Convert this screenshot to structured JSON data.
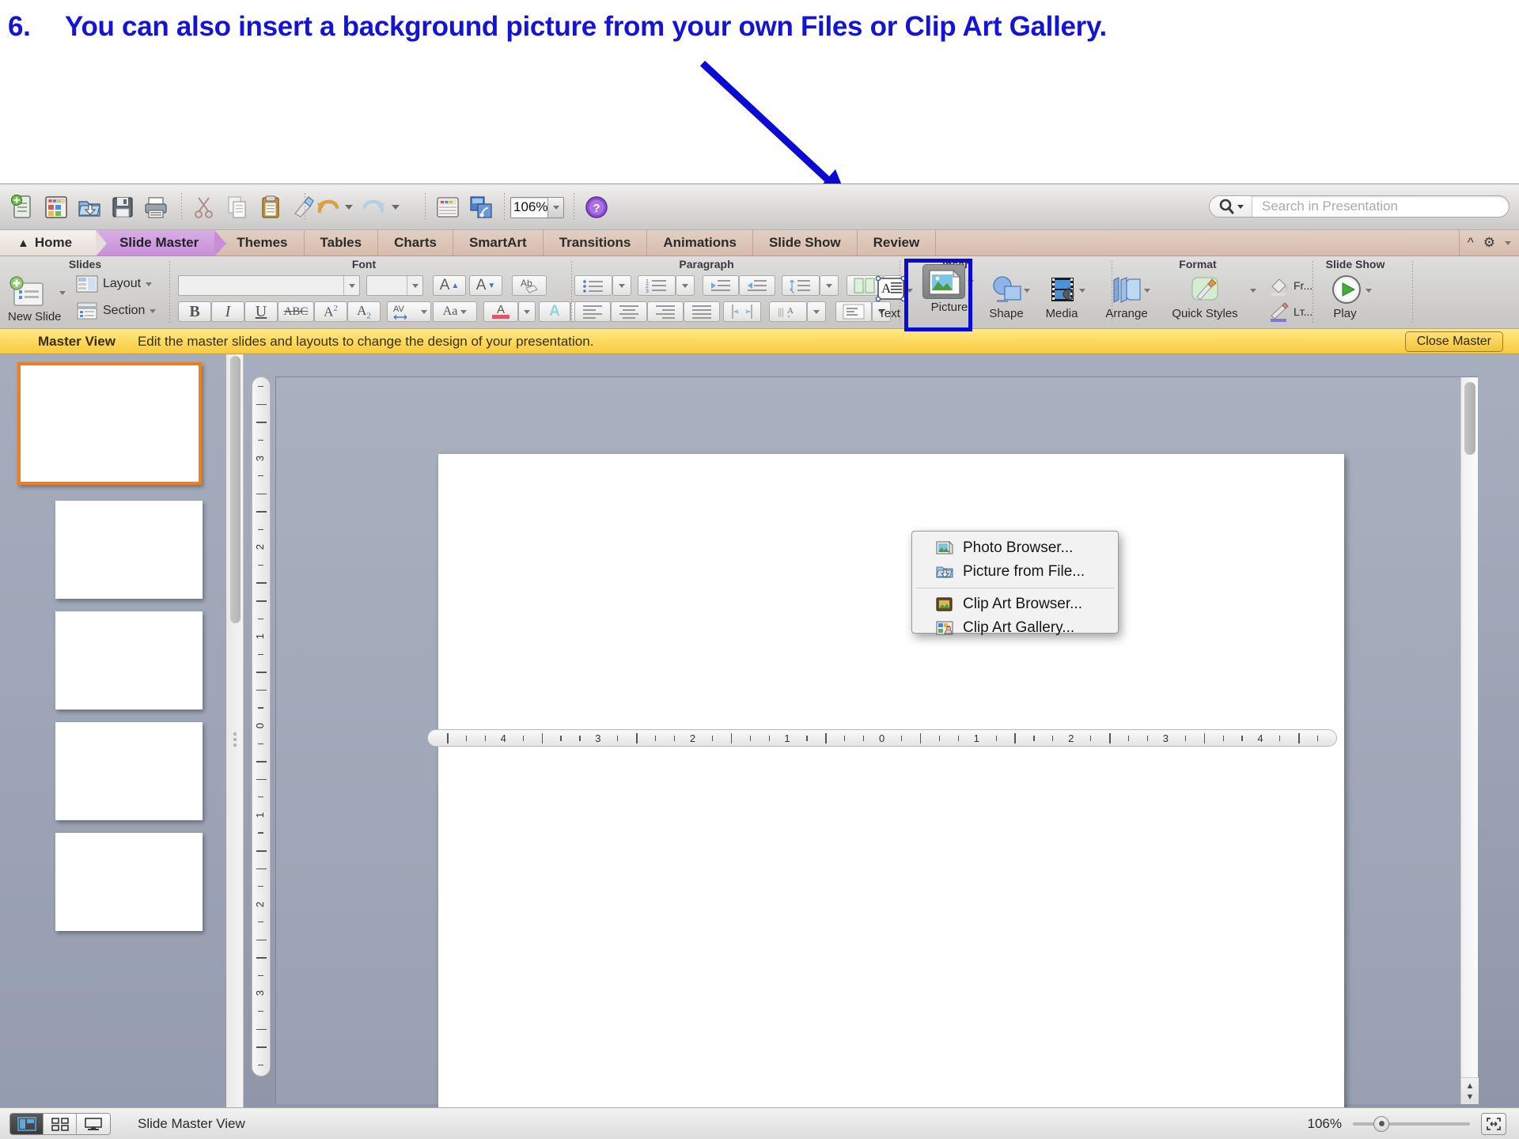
{
  "annotation": {
    "number": "6.",
    "text": "You can also insert a background picture from your own Files or Clip Art Gallery.",
    "color": "#1414d6",
    "arrow_color": "#0a0ad2"
  },
  "standard_toolbar": {
    "buttons": [
      {
        "name": "new-presentation-icon",
        "label": "New"
      },
      {
        "name": "new-slide-icon",
        "label": "New Slide"
      },
      {
        "name": "open-icon",
        "label": "Open"
      },
      {
        "name": "save-icon",
        "label": "Save"
      },
      {
        "name": "print-icon",
        "label": "Print"
      },
      {
        "name": "cut-icon",
        "label": "Cut"
      },
      {
        "name": "copy-icon",
        "label": "Copy"
      },
      {
        "name": "paste-icon",
        "label": "Paste"
      },
      {
        "name": "format-painter-icon",
        "label": "Format"
      },
      {
        "name": "undo-icon",
        "label": "Undo"
      },
      {
        "name": "redo-icon",
        "label": "Redo"
      },
      {
        "name": "format-background-icon",
        "label": "Format Background"
      },
      {
        "name": "media-browser-icon",
        "label": "Media Browser"
      }
    ],
    "zoom_value": "106%",
    "help_label": "?"
  },
  "search": {
    "placeholder": "Search in Presentation",
    "value": ""
  },
  "ribbon": {
    "tabs": [
      {
        "label": "Home",
        "active": false,
        "home": true
      },
      {
        "label": "Slide Master",
        "active": true
      },
      {
        "label": "Themes",
        "active": false
      },
      {
        "label": "Tables",
        "active": false
      },
      {
        "label": "Charts",
        "active": false
      },
      {
        "label": "SmartArt",
        "active": false
      },
      {
        "label": "Transitions",
        "active": false
      },
      {
        "label": "Animations",
        "active": false
      },
      {
        "label": "Slide Show",
        "active": false
      },
      {
        "label": "Review",
        "active": false
      }
    ],
    "groups": [
      {
        "label": "Slides"
      },
      {
        "label": "Font"
      },
      {
        "label": "Paragraph"
      },
      {
        "label": "Insert"
      },
      {
        "label": "Format"
      },
      {
        "label": "Slide Show"
      }
    ],
    "slides_group": {
      "new_slide_label": "New Slide",
      "layout_label": "Layout",
      "section_label": "Section"
    },
    "font_group": {
      "font_name_value": "",
      "font_size_value": "",
      "grow_font_label": "A",
      "shrink_font_label": "A",
      "clear_formatting_label": "Ab",
      "bold_label": "B",
      "italic_label": "I",
      "underline_label": "U",
      "strikethrough_label": "ABC",
      "superscript_label": "A2",
      "subscript_label": "A2",
      "spacing_label": "AV",
      "change_case_label": "Aa",
      "font_color_label": "A",
      "text_effects_label": "A"
    },
    "insert_group": {
      "text_label": "Text",
      "picture_label": "Picture",
      "shape_label": "Shape",
      "media_label": "Media"
    },
    "format_group": {
      "arrange_label": "Arrange",
      "quick_styles_label": "Quick Styles",
      "fill_label": "Fr...",
      "line_label": "Lт..."
    },
    "slideshow_group": {
      "play_label": "Play"
    }
  },
  "picture_menu": {
    "items": [
      {
        "label": "Photo Browser...",
        "icon": "photo-browser-icon"
      },
      {
        "label": "Picture from File...",
        "icon": "picture-from-file-icon"
      },
      {
        "label": "Clip Art Browser...",
        "icon": "clip-art-browser-icon"
      },
      {
        "label": "Clip Art Gallery...",
        "icon": "clip-art-gallery-icon"
      }
    ],
    "separator_after_index": 1
  },
  "master_bar": {
    "title": "Master View",
    "description": "Edit the master slides and layouts to change the design of your presentation.",
    "close_label": "Close Master",
    "background": "#fdd95e"
  },
  "thumbnails": {
    "count": 5,
    "selected_index": 0,
    "selected_color": "#ef7e20"
  },
  "rulers": {
    "horizontal_labels": [
      "4",
      "3",
      "2",
      "1",
      "0",
      "1",
      "2",
      "3",
      "4"
    ],
    "vertical_labels": [
      "3",
      "2",
      "1",
      "0",
      "1",
      "2",
      "3"
    ],
    "units": "inches"
  },
  "status_bar": {
    "view_buttons": [
      {
        "name": "normal-view-button",
        "active": true
      },
      {
        "name": "slide-sorter-view-button",
        "active": false
      },
      {
        "name": "presenter-view-button",
        "active": false
      }
    ],
    "status_text": "Slide Master View",
    "zoom_percent": "106%",
    "fit_label": "Fit"
  }
}
